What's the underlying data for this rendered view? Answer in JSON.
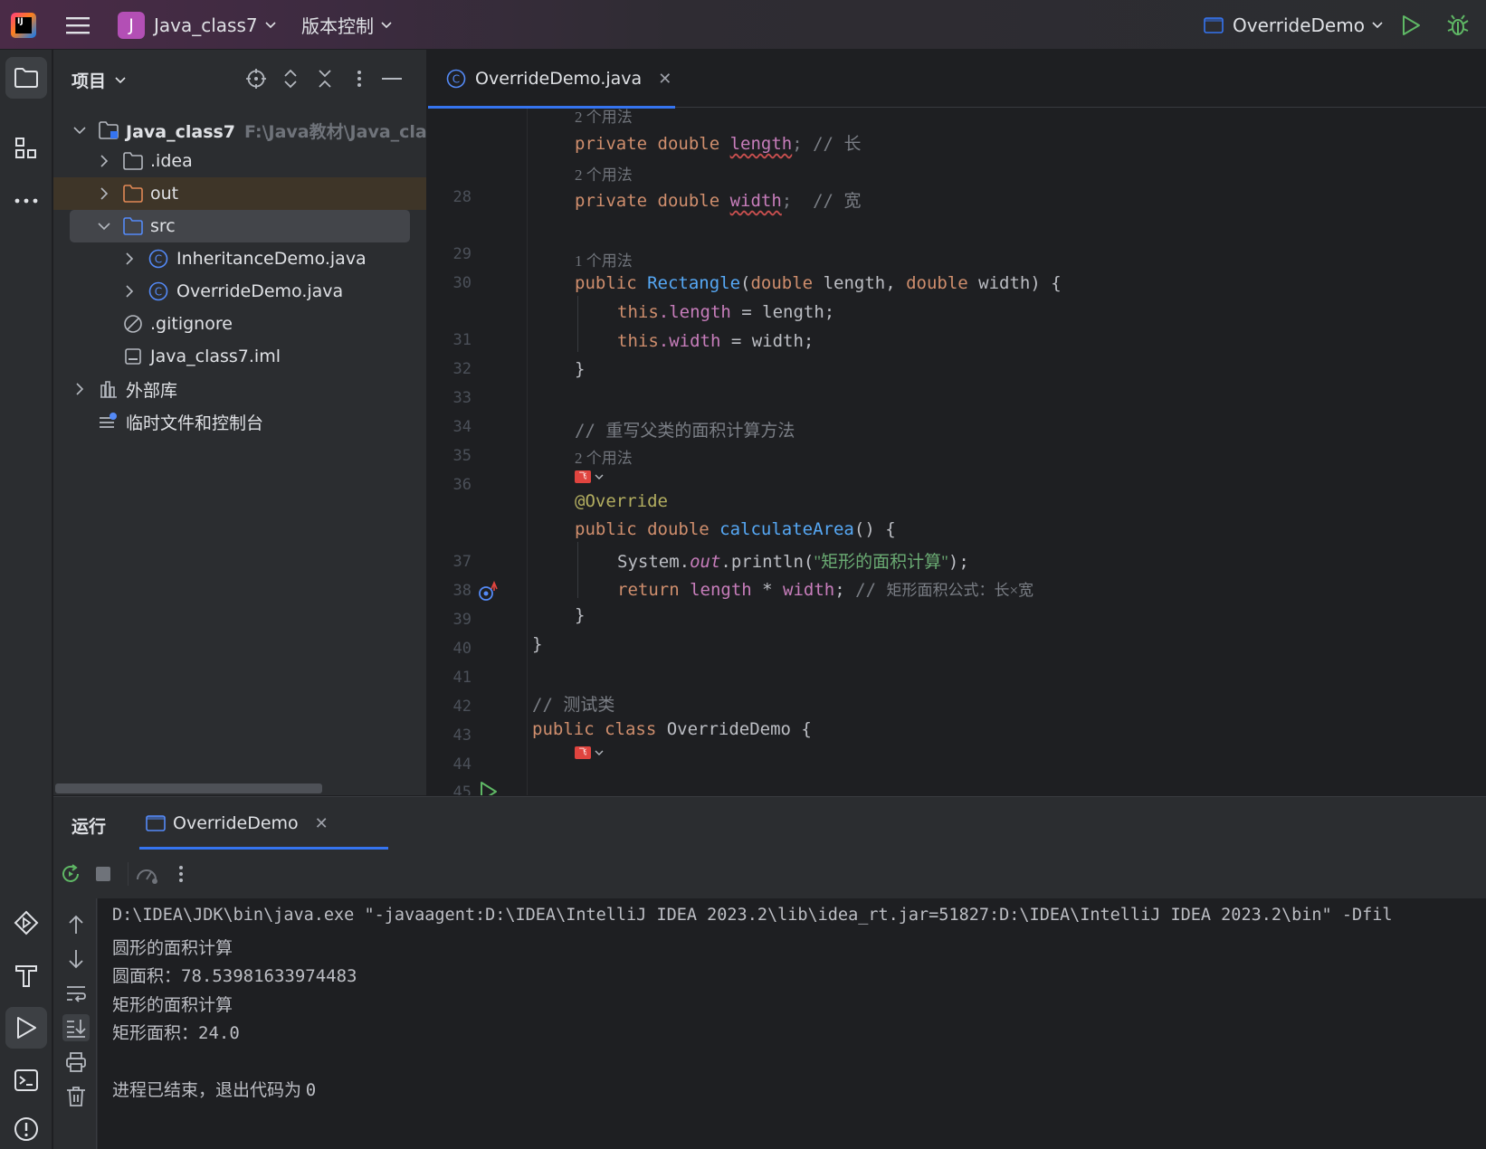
{
  "titlebar": {
    "project_letter": "J",
    "project_name": "Java_class7",
    "vcs_label": "版本控制",
    "run_config": "OverrideDemo"
  },
  "project_panel": {
    "title": "项目",
    "tree": {
      "root": {
        "label": "Java_class7",
        "path": "F:\\Java教材\\Java_clas"
      },
      "idea": ".idea",
      "out": "out",
      "src": "src",
      "file1": "InheritanceDemo.java",
      "file2": "OverrideDemo.java",
      "gitignore": ".gitignore",
      "iml": "Java_class7.iml",
      "ext_libs": "外部库",
      "scratches": "临时文件和控制台"
    }
  },
  "editor": {
    "tab_label": "OverrideDemo.java",
    "usage_hints": {
      "h1": "2 个用法",
      "h2": "2 个用法",
      "h3": "1 个用法",
      "h4": "2 个用法"
    },
    "line_numbers": [
      "28",
      "29",
      "30",
      "31",
      "32",
      "33",
      "34",
      "35",
      "36",
      "37",
      "38",
      "39",
      "40",
      "41",
      "42",
      "43",
      "44",
      "45"
    ],
    "code": {
      "l28_kw": "private double ",
      "l28_field": "length",
      "l28_rest": "; // ",
      "l28_cmt": "长",
      "l29_kw": "private double ",
      "l29_field": "width",
      "l29_rest": ";  // ",
      "l29_cmt": "宽",
      "l31_kw": "public ",
      "l31_fn": "Rectangle",
      "l31_p1": "(",
      "l31_kw2": "double",
      "l31_p2": " length, ",
      "l31_kw3": "double",
      "l31_p3": " width) {",
      "l32_this": "this",
      "l32_field": ".length",
      "l32_rest": " = length;",
      "l33_this": "this",
      "l33_field": ".width",
      "l33_rest": " = width;",
      "l34": "}",
      "l36_slash": "// ",
      "l36_cmt": "重写父类的面积计算方法",
      "l37": "@Override",
      "l38_kw": "public double ",
      "l38_fn": "calculateArea",
      "l38_rest": "() {",
      "l39_a": "System.",
      "l39_out": "out",
      "l39_b": ".println(",
      "l39_str": "\"矩形的面积计算\"",
      "l39_c": ");",
      "l40_kw": "return ",
      "l40_f1": "length",
      "l40_mid": " * ",
      "l40_f2": "width",
      "l40_semi": "; ",
      "l40_slash": "// ",
      "l40_cmt": "矩形面积公式：长×宽",
      "l41": "}",
      "l42": "}",
      "l44_slash": "// ",
      "l44_cmt": "测试类",
      "l45_kw": "public class ",
      "l45_name": "OverrideDemo {"
    }
  },
  "run_panel": {
    "title": "运行",
    "tab_label": "OverrideDemo",
    "console": {
      "cmd": "D:\\IDEA\\JDK\\bin\\java.exe \"-javaagent:D:\\IDEA\\IntelliJ IDEA 2023.2\\lib\\idea_rt.jar=51827:D:\\IDEA\\IntelliJ IDEA 2023.2\\bin\" -Dfil",
      "l1": "圆形的面积计算",
      "l2_label": "圆面积：",
      "l2_val": "78.53981633974483",
      "l3": "矩形的面积计算",
      "l4_label": "矩形面积：",
      "l4_val": "24.0",
      "l5_label": "进程已结束，退出代码为 ",
      "l5_val": "0"
    }
  },
  "colors": {
    "accent": "#3574f0",
    "keyword": "#cf8e6d",
    "field": "#c77dbb",
    "function": "#56a8f5",
    "string": "#6aab73",
    "comment": "#7a7e85",
    "run_green": "#5fb865"
  }
}
